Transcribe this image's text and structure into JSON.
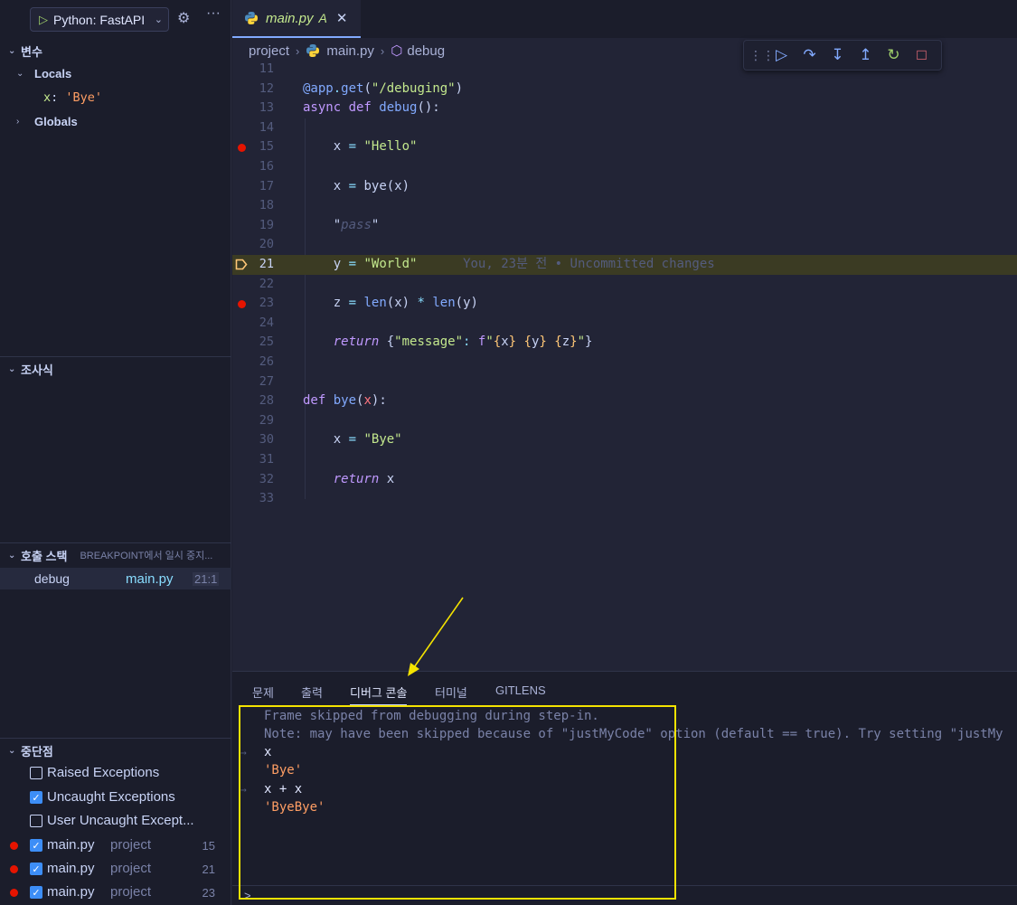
{
  "debug_toolbar": {
    "launch_config": "Python: FastAPI",
    "icons": [
      "play-icon",
      "chevron-down-icon",
      "gear-icon",
      "more-icon"
    ]
  },
  "variables": {
    "title": "변수",
    "locals_label": "Locals",
    "locals": [
      {
        "name": "x",
        "value": "'Bye'"
      }
    ],
    "globals_label": "Globals"
  },
  "watch": {
    "title": "조사식"
  },
  "call_stack": {
    "title": "호출 스택",
    "status": "BREAKPOINT에서 일시 중지...",
    "frames": [
      {
        "name": "debug",
        "file": "main.py",
        "pos": "21:1"
      }
    ]
  },
  "breakpoints": {
    "title": "중단점",
    "exceptions": [
      {
        "label": "Raised Exceptions",
        "checked": false
      },
      {
        "label": "Uncaught Exceptions",
        "checked": true
      },
      {
        "label": "User Uncaught Except...",
        "checked": false
      }
    ],
    "files": [
      {
        "file": "main.py",
        "project": "project",
        "line": "15"
      },
      {
        "file": "main.py",
        "project": "project",
        "line": "21"
      },
      {
        "file": "main.py",
        "project": "project",
        "line": "23"
      }
    ]
  },
  "editor": {
    "tab": {
      "name": "main.py",
      "status": "A"
    },
    "breadcrumb": [
      "project",
      "main.py",
      "debug"
    ],
    "floating_toolbar": [
      "grip-icon",
      "continue-icon",
      "step-over-icon",
      "step-into-icon",
      "step-out-icon",
      "restart-icon",
      "stop-icon"
    ],
    "line_numbers": [
      "11",
      "12",
      "13",
      "14",
      "15",
      "16",
      "17",
      "18",
      "19",
      "20",
      "21",
      "22",
      "23",
      "24",
      "25",
      "26",
      "27",
      "28",
      "29",
      "30",
      "31",
      "32",
      "33"
    ],
    "current_line": "21",
    "breakpoint_lines": [
      "15",
      "23"
    ],
    "blame": "You, 23분 전 • Uncommitted changes"
  },
  "panel": {
    "tabs": [
      "문제",
      "출력",
      "디버그 콘솔",
      "터미널",
      "GITLENS"
    ],
    "active_tab": "디버그 콘솔",
    "console": [
      {
        "kind": "info",
        "text": "Frame skipped from debugging during step-in."
      },
      {
        "kind": "info",
        "text": "Note: may have been skipped because of \"justMyCode\" option (default == true). Try setting \"justMy"
      },
      {
        "kind": "cmd",
        "text": "x"
      },
      {
        "kind": "res",
        "text": "'Bye'"
      },
      {
        "kind": "cmd",
        "text": "x + x"
      },
      {
        "kind": "res",
        "text": "'ByeBye'"
      }
    ],
    "prompt": ">"
  },
  "colors": {
    "accent": "#82aaff",
    "breakpoint": "#e51400",
    "current_line_bg": "#3b3b23",
    "annotation": "#f4e300"
  }
}
